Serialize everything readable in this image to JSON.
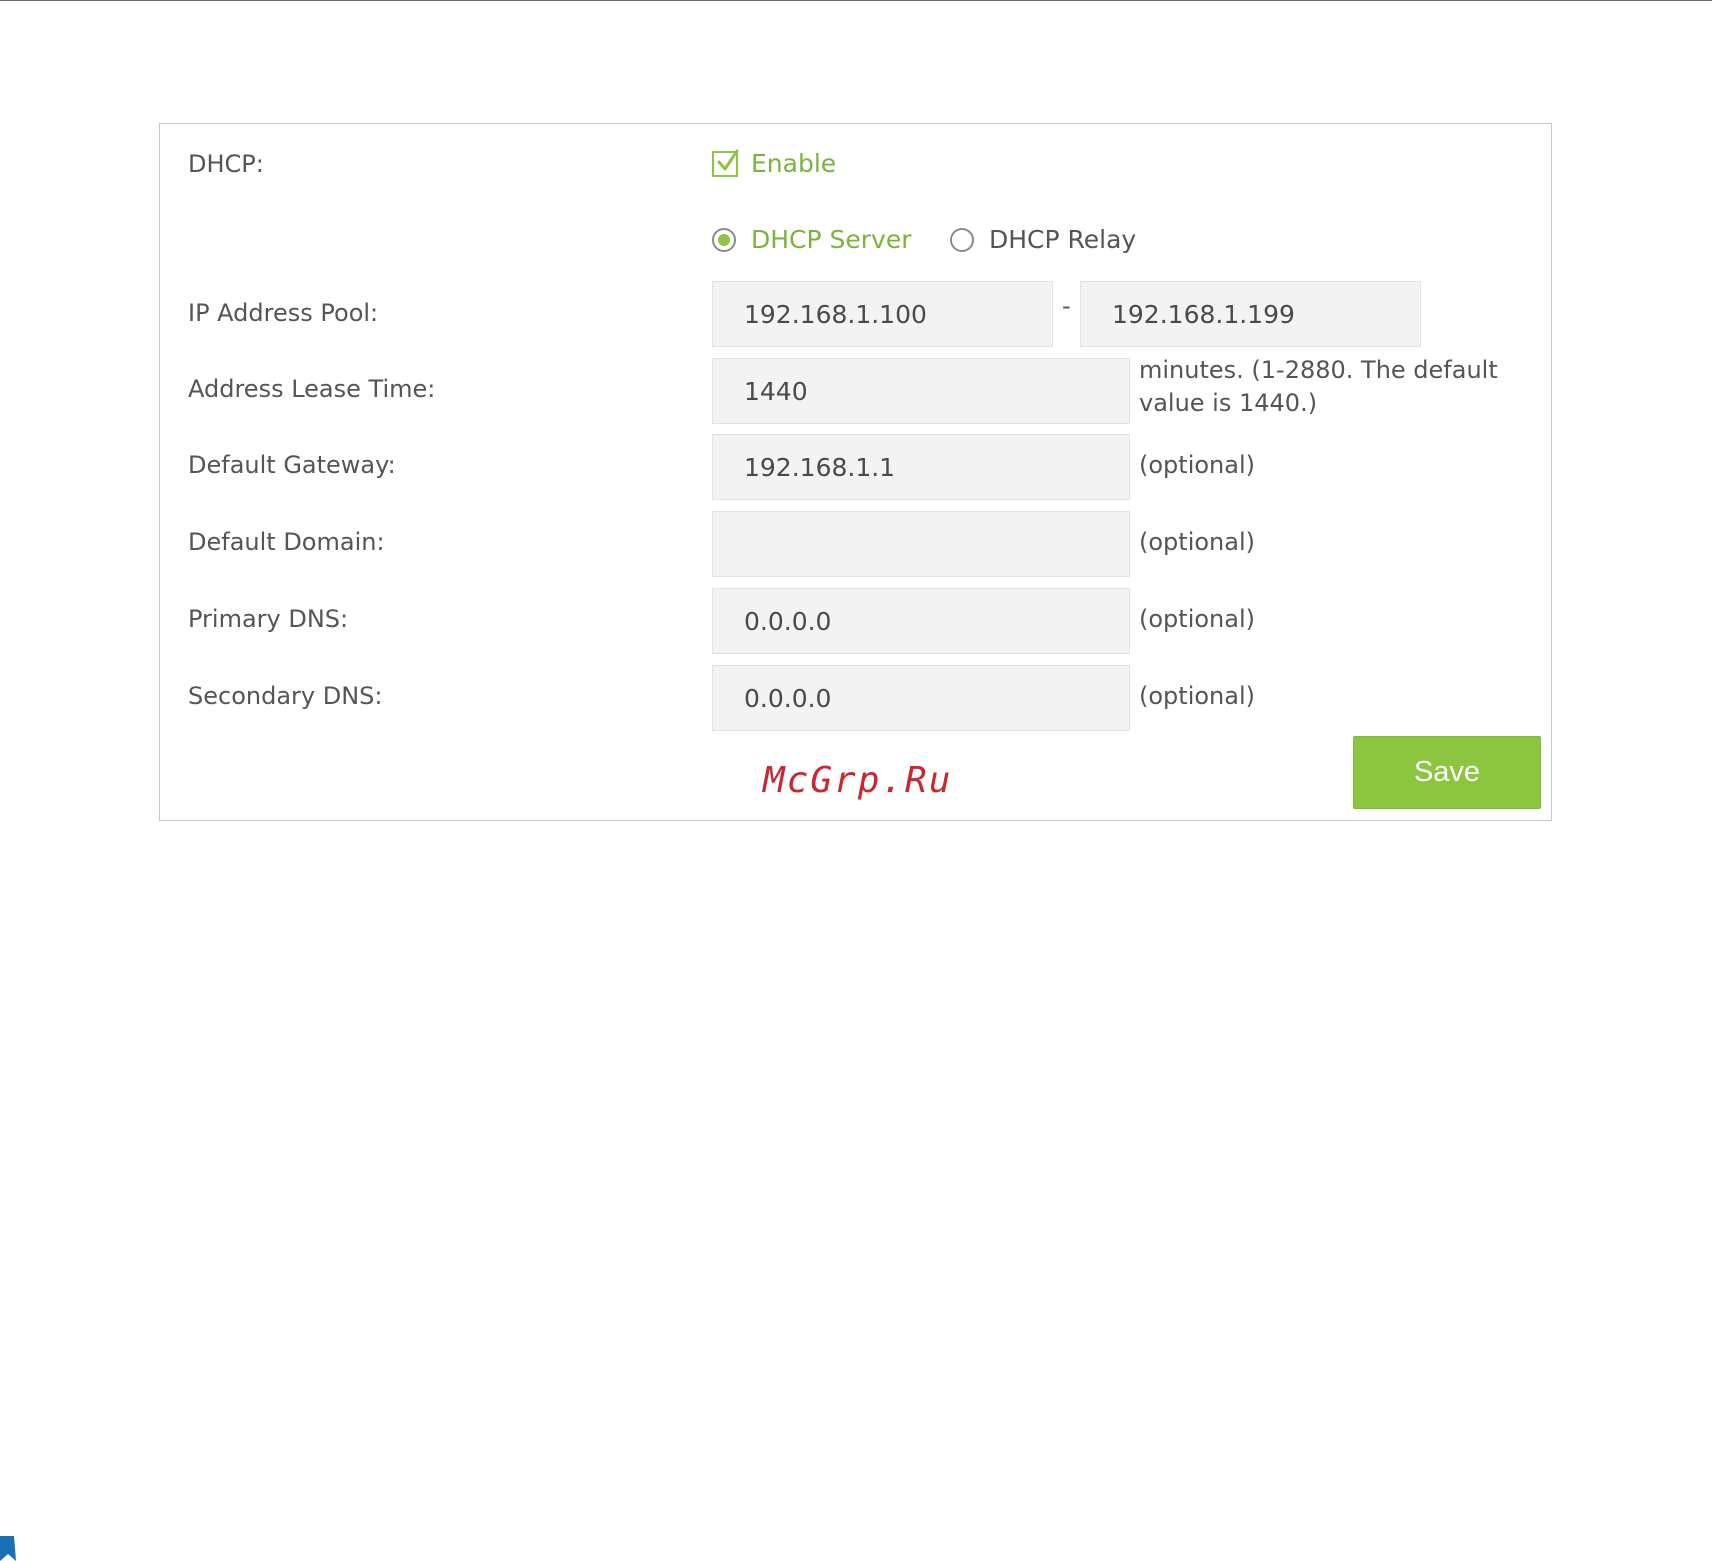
{
  "form": {
    "dhcp_label": "DHCP:",
    "enable_label": "Enable",
    "enable_checked": true,
    "mode_options": [
      "DHCP Server",
      "DHCP Relay"
    ],
    "mode_selected": "DHCP Server",
    "ip_pool_label": "IP Address Pool:",
    "ip_pool_start": "192.168.1.100",
    "ip_pool_separator": "-",
    "ip_pool_end": "192.168.1.199",
    "lease_label": "Address Lease Time:",
    "lease_value": "1440",
    "lease_hint_line1": "minutes. (1-2880. The default",
    "lease_hint_line2": "value is 1440.)",
    "gateway_label": "Default Gateway:",
    "gateway_value": "192.168.1.1",
    "domain_label": "Default Domain:",
    "domain_value": "",
    "primary_dns_label": "Primary DNS:",
    "primary_dns_value": "0.0.0.0",
    "secondary_dns_label": "Secondary DNS:",
    "secondary_dns_value": "0.0.0.0",
    "optional_hint": "(optional)",
    "save_label": "Save"
  },
  "watermark": "McGrp.Ru",
  "colors": {
    "accent_green": "#8cc63f",
    "accent_green_text": "#7ab43a",
    "field_bg": "#f3f3f3",
    "watermark_red": "#c8282e",
    "corner_blue": "#1a6fb5"
  }
}
